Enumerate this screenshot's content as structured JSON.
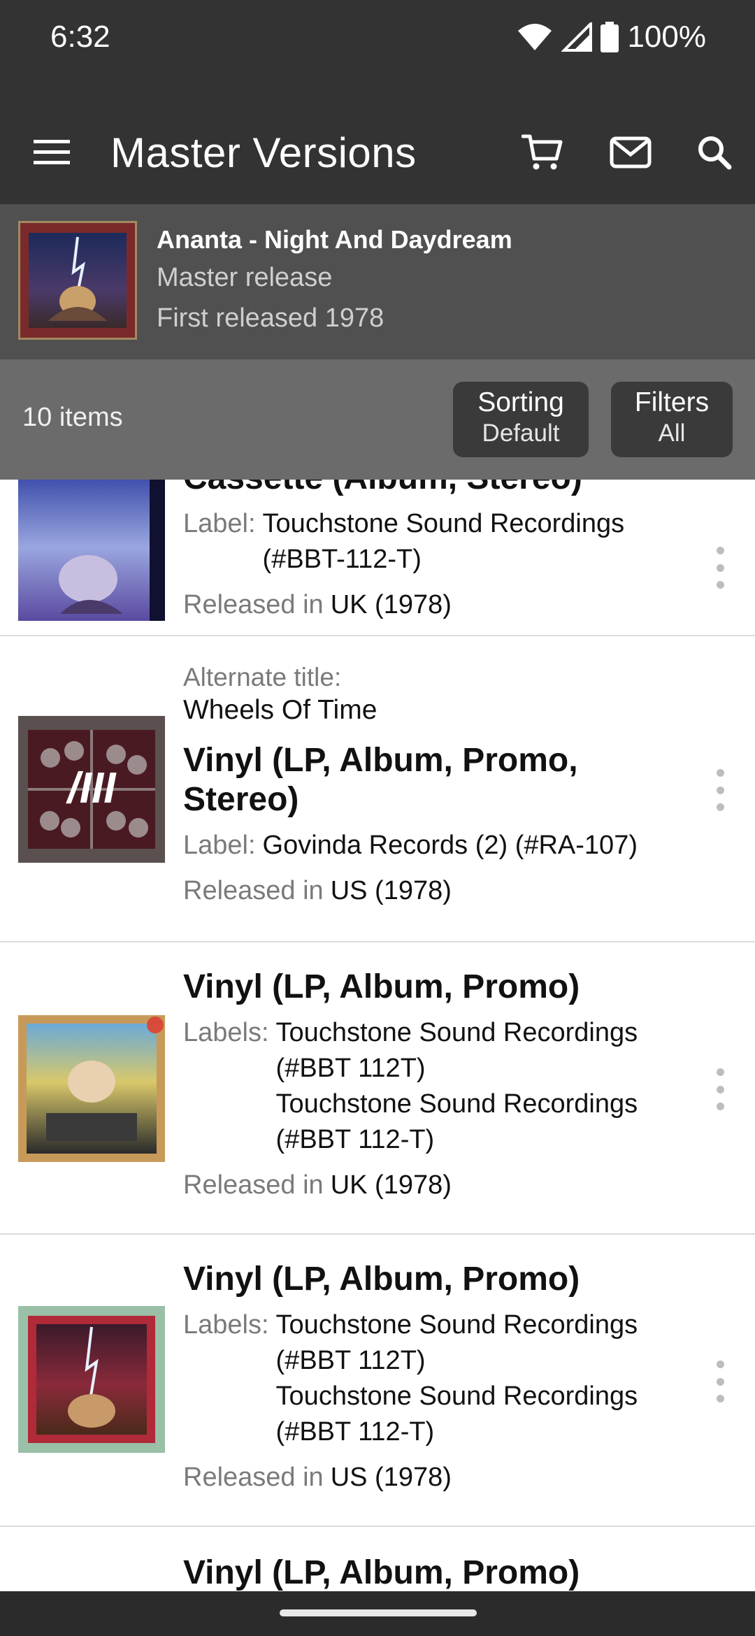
{
  "status_bar": {
    "time": "6:32",
    "battery": "100%"
  },
  "app_bar": {
    "title": "Master Versions"
  },
  "release": {
    "title": "Ananta - Night And Daydream",
    "type": "Master release",
    "first_released": "First released 1978"
  },
  "toolbar": {
    "count": "10 items",
    "sorting_label": "Sorting",
    "sorting_value": "Default",
    "filters_label": "Filters",
    "filters_value": "All"
  },
  "items": [
    {
      "format": "Cassette (Album, Stereo)",
      "label_key": "Label:",
      "label_value": "Touchstone Sound Recordings (#BBT-112-T)",
      "released_key": "Released in",
      "released_value": "UK (1978)"
    },
    {
      "alt_title_label": "Alternate title:",
      "alt_title": "Wheels Of Time",
      "format": "Vinyl (LP, Album, Promo, Stereo)",
      "label_key": "Label:",
      "label_value": "Govinda Records (2) (#RA-107)",
      "released_key": "Released in",
      "released_value": "US (1978)"
    },
    {
      "format": "Vinyl (LP, Album, Promo)",
      "label_key": "Labels:",
      "label_value_1": "Touchstone Sound Recordings (#BBT 112T)",
      "label_value_2": "Touchstone Sound Recordings (#BBT 112-T)",
      "released_key": "Released in",
      "released_value": "UK (1978)"
    },
    {
      "format": "Vinyl (LP, Album, Promo)",
      "label_key": "Labels:",
      "label_value_1": "Touchstone Sound Recordings (#BBT 112T)",
      "label_value_2": "Touchstone Sound Recordings (#BBT 112-T)",
      "released_key": "Released in",
      "released_value": "US (1978)"
    },
    {
      "format": "Vinyl (LP, Album, Promo)"
    }
  ],
  "icons": {
    "menu": "menu-icon",
    "cart": "cart-icon",
    "mail": "mail-icon",
    "search": "search-icon",
    "more": "more-vert-icon"
  },
  "colors": {
    "app_bar": "#333333",
    "release_header": "#505050",
    "toolbar": "#6b6b6b",
    "pill": "#3a3a3a"
  }
}
